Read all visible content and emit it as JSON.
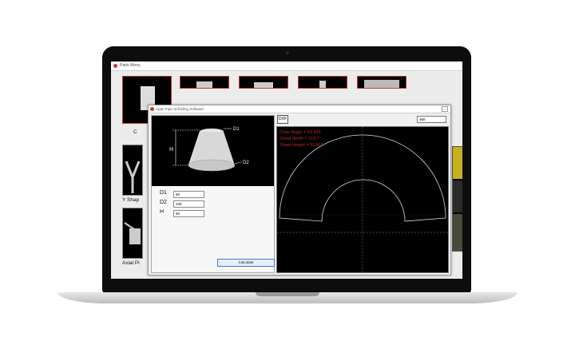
{
  "parent_window": {
    "title": "Parts Menu",
    "labels": [
      "C",
      "Y Shap",
      "Axial Pi"
    ]
  },
  "dialog": {
    "title": "Apan Pipe Unfolding Software",
    "close_icon": "□",
    "dxf_label": "DXF",
    "angle_value": "360",
    "image_labels": {
      "d1": "D1",
      "d2": "D2",
      "h": "H"
    },
    "params": [
      {
        "label": "D1",
        "value": "50"
      },
      {
        "label": "D2",
        "value": "100"
      },
      {
        "label": "H",
        "value": "50"
      }
    ],
    "calculate_label": "Calculate",
    "results": {
      "cone_angle": "Cone Angle = 63,435",
      "sheet_width": "Sheet Width = 110,7",
      "sheet_height": "Sheet Height = 51,803"
    }
  },
  "colors": {
    "accent_red": "#c0392b",
    "result_text": "#b82b2b",
    "drawing_line": "#d9d9d9",
    "button_border": "#3b7bd4"
  }
}
